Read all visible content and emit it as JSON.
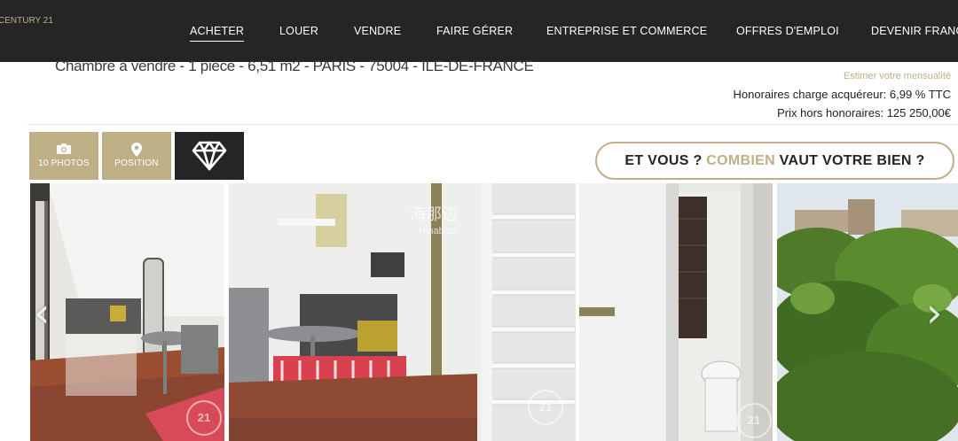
{
  "brand": {
    "logo_text": "CENTURY 21",
    "tm": "."
  },
  "nav": {
    "items": [
      {
        "label": "ACHETER",
        "active": true
      },
      {
        "label": "LOUER"
      },
      {
        "label": "VENDRE"
      },
      {
        "label": "FAIRE GÉRER"
      },
      {
        "label": "ENTREPRISE ET COMMERCE"
      },
      {
        "label": "OFFRES D'EMPLOI"
      },
      {
        "label": "DEVENIR FRANC"
      }
    ]
  },
  "listing": {
    "title": "Chambre à vendre - 1 pièce - 6,51 m2 - PARIS - 75004 - ILE-DE-FRANCE",
    "estimate_link": "Estimer votre mensualité",
    "fees": "Honoraires charge acquéreur: 6,99 % TTC",
    "price_net": "Prix hors honoraires: 125 250,00€"
  },
  "tiles": {
    "photos_label": "10 PHOTOS",
    "position_label": "POSITION"
  },
  "cta": {
    "part1": "ET VOUS ? ",
    "accent": "COMBIEN",
    "part2": " VAUT VOTRE BIEN ?"
  },
  "gallery": {
    "watermark_cn": "海那边",
    "watermark_en": "Hinabian",
    "logo_mark": "21",
    "prev_arrow": "‹",
    "next_arrow": "›"
  },
  "colors": {
    "gold": "#beaf87",
    "dark": "#252526"
  },
  "icons": [
    "camera-icon",
    "map-pin-icon",
    "diamond-icon",
    "chevron-left-icon",
    "chevron-right-icon"
  ]
}
